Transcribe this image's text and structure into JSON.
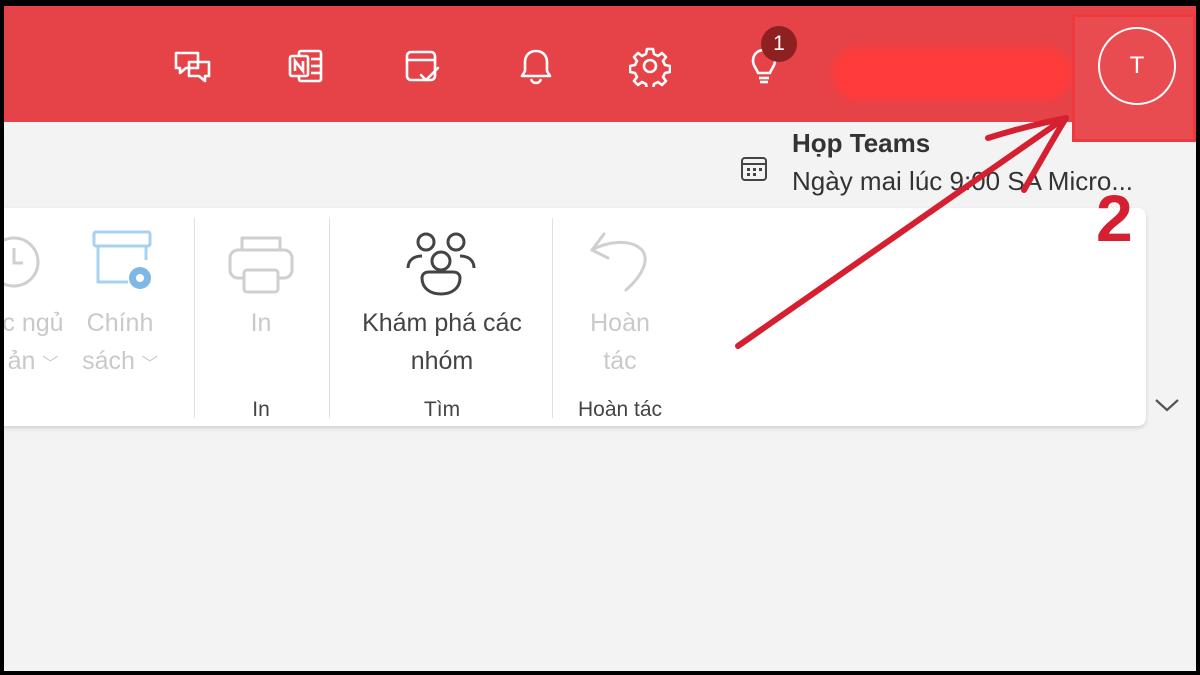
{
  "topbar": {
    "icons": [
      "feedback-chat-icon",
      "onenote-icon",
      "my-day-icon",
      "bell-icon",
      "gear-icon",
      "lightbulb-icon"
    ],
    "tips_badge": "1",
    "avatar_initial": "T"
  },
  "meeting": {
    "title": "Họp Teams",
    "subtitle": "Ngày mai lúc 9:00 SA Micro..."
  },
  "ribbon": {
    "snooze_line1": "c ngủ",
    "snooze_line2": "ản",
    "policy_line1": "Chính",
    "policy_line2": "sách",
    "print_label": "In",
    "print_group": "In",
    "discover_line1": "Khám phá các",
    "discover_line2": "nhóm",
    "find_group": "Tìm",
    "undo_line1": "Hoàn",
    "undo_line2": "tác",
    "undo_group": "Hoàn tác"
  },
  "annotation": {
    "step_number": "2"
  },
  "colors": {
    "topbar": "#e64348",
    "annotation": "#d42031",
    "badge": "#8d2021"
  }
}
